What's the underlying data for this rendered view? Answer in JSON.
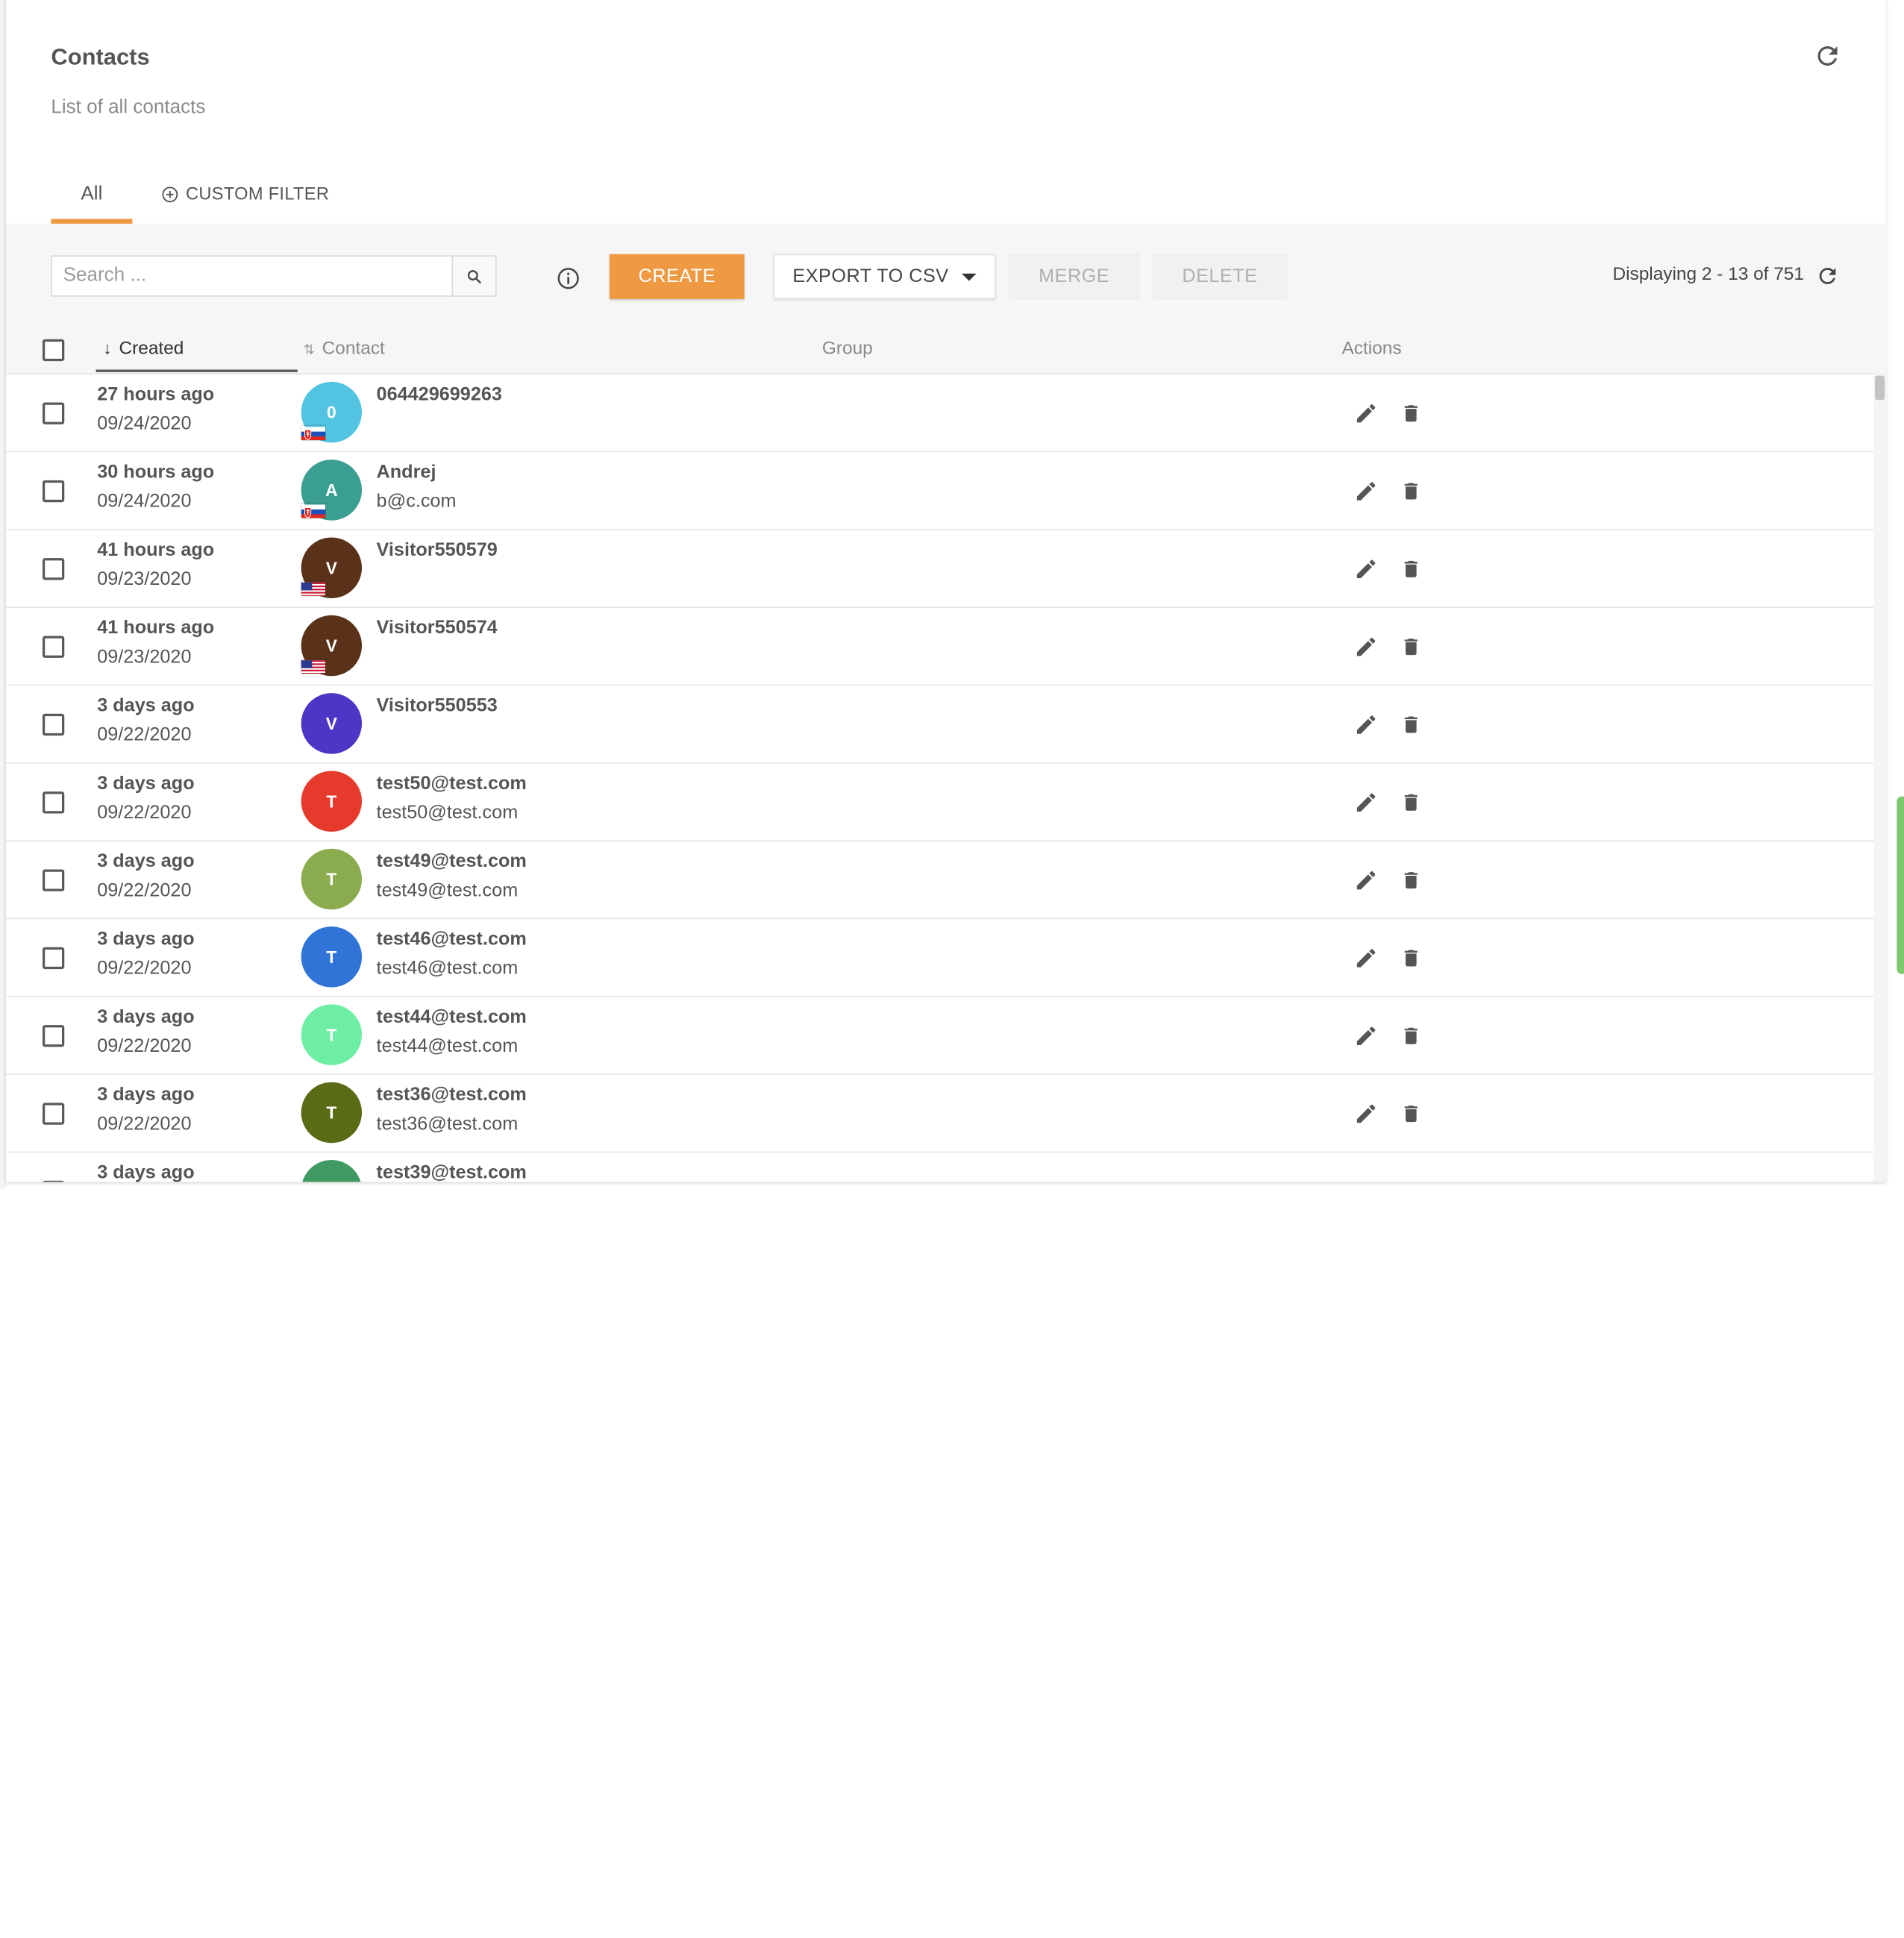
{
  "header": {
    "title": "Contacts",
    "subtitle": "List of all contacts",
    "tabs": [
      {
        "label": "All",
        "active": true
      },
      {
        "label": "CUSTOM FILTER",
        "active": false
      }
    ]
  },
  "toolbar": {
    "search_placeholder": "Search ...",
    "create_label": "CREATE",
    "export_label": "EXPORT TO CSV",
    "merge_label": "MERGE",
    "delete_label": "DELETE",
    "displaying": "Displaying 2 - 13 of 751"
  },
  "columns": {
    "created": "Created",
    "contact": "Contact",
    "group": "Group",
    "actions": "Actions"
  },
  "colors": {
    "accent": "#ee9a43"
  },
  "rows": [
    {
      "when": "27 hours ago",
      "date": "09/24/2020",
      "initial": "0",
      "color": "#52c3e1",
      "flag": "sk",
      "name": "064429699263",
      "email": ""
    },
    {
      "when": "30 hours ago",
      "date": "09/24/2020",
      "initial": "A",
      "color": "#3a9e90",
      "flag": "sk",
      "name": "Andrej",
      "email": "b@c.com"
    },
    {
      "when": "41 hours ago",
      "date": "09/23/2020",
      "initial": "V",
      "color": "#5a3219",
      "flag": "us",
      "name": "Visitor550579",
      "email": ""
    },
    {
      "when": "41 hours ago",
      "date": "09/23/2020",
      "initial": "V",
      "color": "#5a3219",
      "flag": "us",
      "name": "Visitor550574",
      "email": ""
    },
    {
      "when": "3 days ago",
      "date": "09/22/2020",
      "initial": "V",
      "color": "#4b36c6",
      "flag": "",
      "name": "Visitor550553",
      "email": ""
    },
    {
      "when": "3 days ago",
      "date": "09/22/2020",
      "initial": "T",
      "color": "#e63a2c",
      "flag": "",
      "name": "test50@test.com",
      "email": "test50@test.com"
    },
    {
      "when": "3 days ago",
      "date": "09/22/2020",
      "initial": "T",
      "color": "#8aac4e",
      "flag": "",
      "name": "test49@test.com",
      "email": "test49@test.com"
    },
    {
      "when": "3 days ago",
      "date": "09/22/2020",
      "initial": "T",
      "color": "#2f74d6",
      "flag": "",
      "name": "test46@test.com",
      "email": "test46@test.com"
    },
    {
      "when": "3 days ago",
      "date": "09/22/2020",
      "initial": "T",
      "color": "#6eeea5",
      "flag": "",
      "name": "test44@test.com",
      "email": "test44@test.com"
    },
    {
      "when": "3 days ago",
      "date": "09/22/2020",
      "initial": "T",
      "color": "#5a6b15",
      "flag": "",
      "name": "test36@test.com",
      "email": "test36@test.com"
    },
    {
      "when": "3 days ago",
      "date": "",
      "initial": "T",
      "color": "#3f9a63",
      "flag": "",
      "name": "test39@test.com",
      "email": ""
    }
  ]
}
